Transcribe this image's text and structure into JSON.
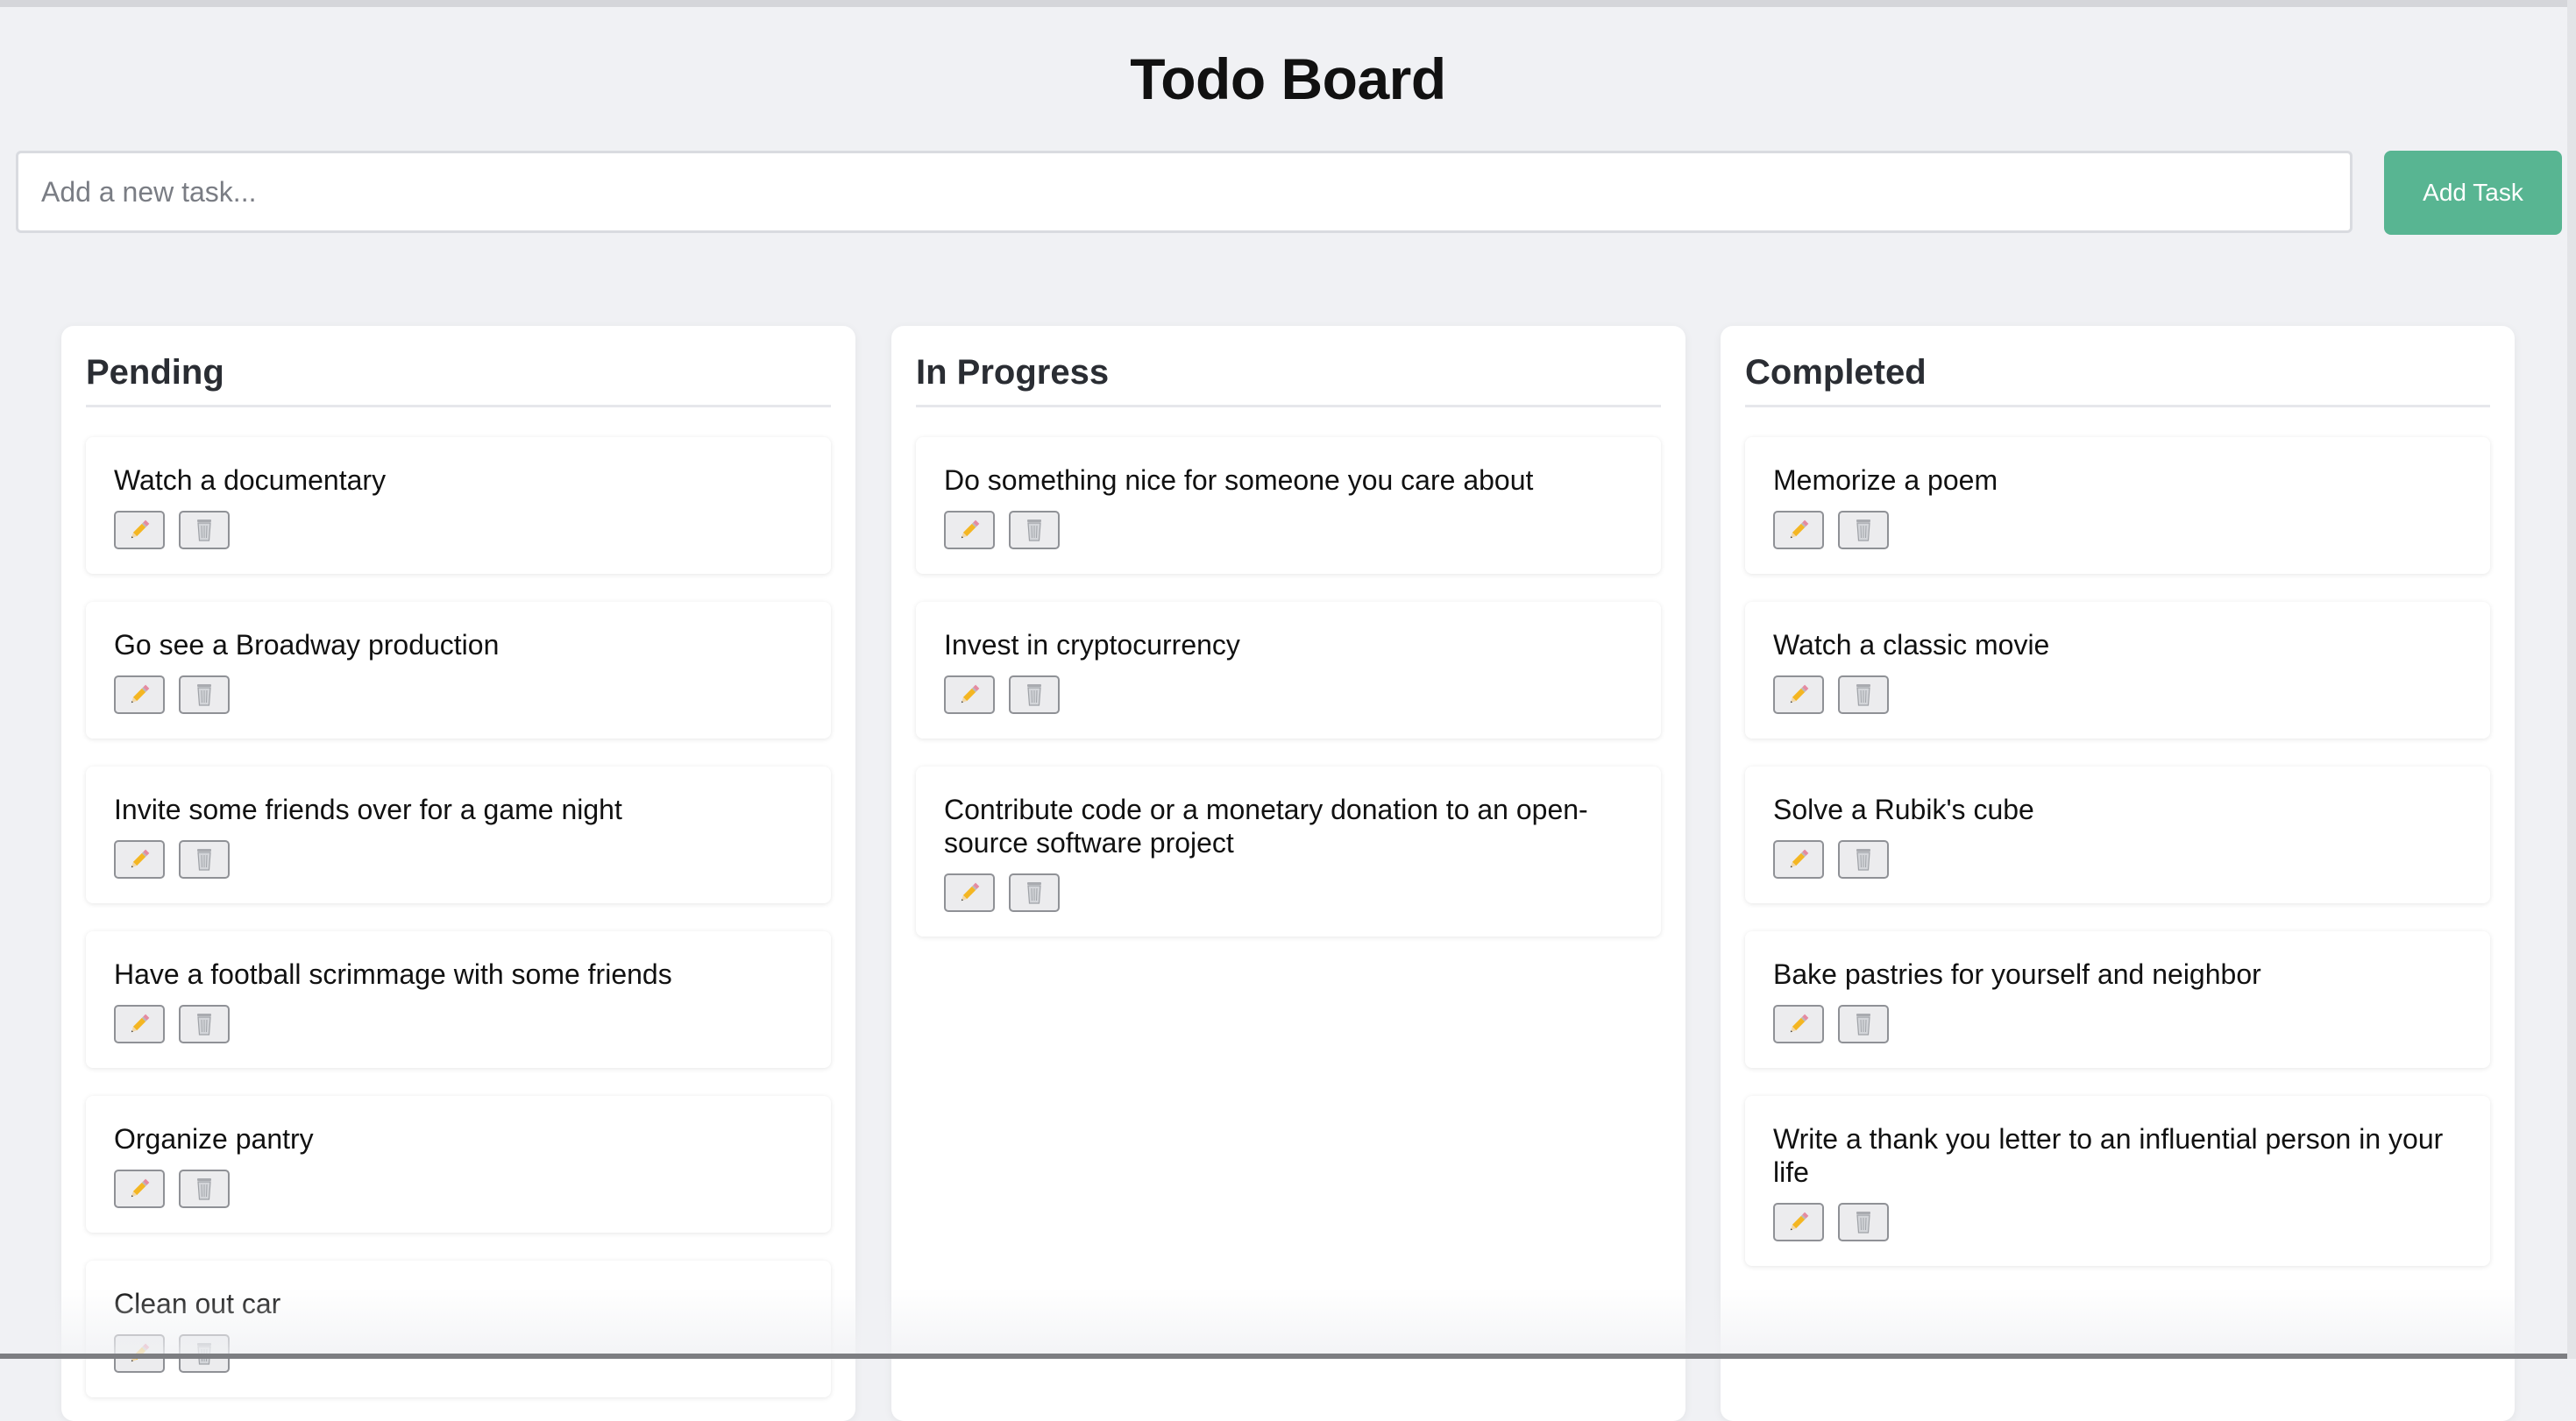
{
  "header": {
    "title": "Todo Board"
  },
  "new_task": {
    "placeholder": "Add a new task...",
    "value": "",
    "add_label": "Add Task"
  },
  "accent_color": "#58b592",
  "columns": [
    {
      "title": "Pending",
      "tasks": [
        {
          "text": "Watch a documentary"
        },
        {
          "text": "Go see a Broadway production"
        },
        {
          "text": "Invite some friends over for a game night"
        },
        {
          "text": "Have a football scrimmage with some friends"
        },
        {
          "text": "Organize pantry"
        },
        {
          "text": "Clean out car"
        }
      ]
    },
    {
      "title": "In Progress",
      "tasks": [
        {
          "text": "Do something nice for someone you care about"
        },
        {
          "text": "Invest in cryptocurrency"
        },
        {
          "text": "Contribute code or a monetary donation to an open-source software project"
        }
      ]
    },
    {
      "title": "Completed",
      "tasks": [
        {
          "text": "Memorize a poem"
        },
        {
          "text": "Watch a classic movie"
        },
        {
          "text": "Solve a Rubik's cube"
        },
        {
          "text": "Bake pastries for yourself and neighbor"
        },
        {
          "text": "Write a thank you letter to an influential person in your life"
        }
      ]
    }
  ],
  "icons": {
    "edit": "pencil-icon",
    "delete": "trash-icon"
  }
}
